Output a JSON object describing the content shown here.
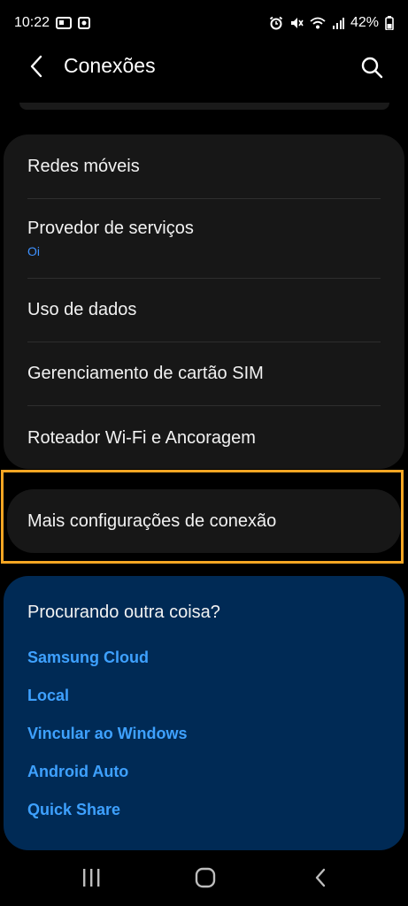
{
  "status": {
    "time": "10:22",
    "battery": "42%",
    "left_icons": [
      "id-card-icon",
      "notification-square-icon"
    ],
    "right_icons": [
      "alarm-icon",
      "mute-icon",
      "wifi-icon",
      "signal-icon",
      "battery-icon"
    ]
  },
  "header": {
    "title": "Conexões"
  },
  "settings": {
    "items": [
      {
        "title": "Redes móveis",
        "subtitle": ""
      },
      {
        "title": "Provedor de serviços",
        "subtitle": "Oi"
      },
      {
        "title": "Uso de dados",
        "subtitle": ""
      },
      {
        "title": "Gerenciamento de cartão SIM",
        "subtitle": ""
      },
      {
        "title": "Roteador Wi-Fi e Ancoragem",
        "subtitle": ""
      }
    ],
    "more": "Mais configurações de conexão"
  },
  "looking_for": {
    "title": "Procurando outra coisa?",
    "links": [
      "Samsung Cloud",
      "Local",
      "Vincular ao Windows",
      "Android Auto",
      "Quick Share"
    ]
  },
  "colors": {
    "highlight": "#f5a623",
    "link": "#3ea1ff",
    "card": "#171717",
    "looking_card": "#002a55"
  }
}
